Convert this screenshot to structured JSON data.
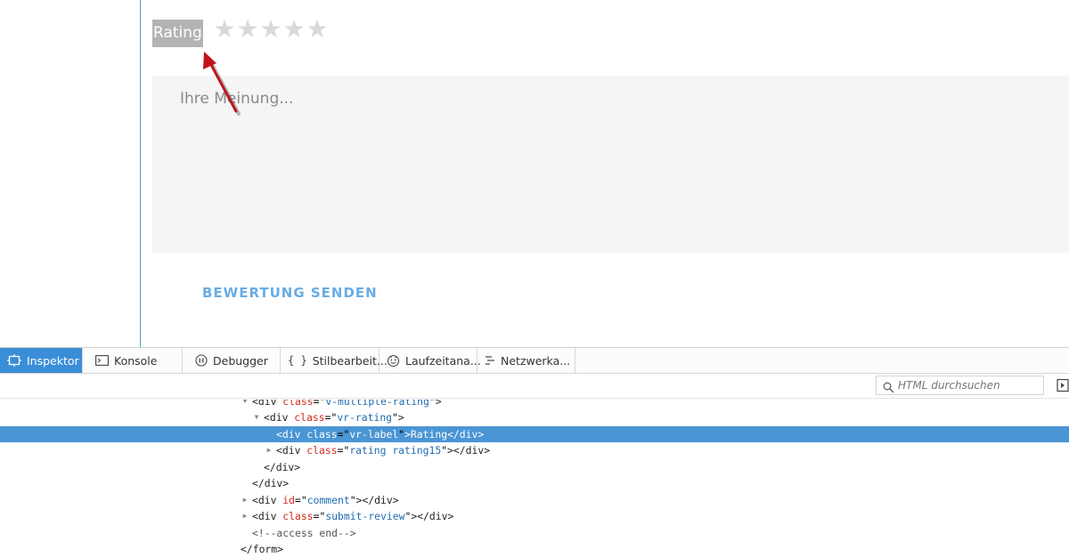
{
  "page": {
    "rating_label": "Rating",
    "rating": {
      "value": 0,
      "max": 5
    },
    "star_glyph": "★",
    "comment_placeholder": "Ihre Meinung...",
    "submit_label": "BEWERTUNG SENDEN"
  },
  "devtools": {
    "tabs": [
      {
        "label": "Inspektor",
        "icon": "inspector-icon",
        "active": true
      },
      {
        "label": "Konsole",
        "icon": "console-icon",
        "active": false
      },
      {
        "label": "Debugger",
        "icon": "debugger-icon",
        "active": false
      },
      {
        "label": "Stilbearbeit...",
        "icon": "style-editor-icon",
        "active": false
      },
      {
        "label": "Laufzeitana...",
        "icon": "performance-icon",
        "active": false
      },
      {
        "label": "Netzwerka...",
        "icon": "network-icon",
        "active": false
      }
    ],
    "search_placeholder": "HTML durchsuchen",
    "selected_node_index": 2,
    "nodes": [
      {
        "twisty": "open",
        "open": "<",
        "tag": "div",
        "attr": "class",
        "value": "v-multiple-rating",
        "close": ">"
      },
      {
        "twisty": "open",
        "open": "<",
        "tag": "div",
        "attr": "class",
        "value": "vr-rating",
        "close": ">"
      },
      {
        "twisty": "none",
        "open": "<",
        "tag": "div",
        "attr": "class",
        "value": "vr-label",
        "close": ">",
        "text": "Rating",
        "end": "</div>"
      },
      {
        "twisty": "closed",
        "open": "<",
        "tag": "div",
        "attr": "class",
        "value": "rating rating15",
        "close": ">",
        "end": "</div>"
      },
      {
        "twisty": "none",
        "raw": "</div>"
      },
      {
        "twisty": "none",
        "raw": "</div>"
      },
      {
        "twisty": "closed",
        "open": "<",
        "tag": "div",
        "attr": "id",
        "value": "comment",
        "close": ">",
        "end": "</div>"
      },
      {
        "twisty": "closed",
        "open": "<",
        "tag": "div",
        "attr": "class",
        "value": "submit-review",
        "close": ">",
        "end": "</div>"
      },
      {
        "twisty": "none",
        "comment": "<!--access end-->"
      },
      {
        "twisty": "none",
        "raw": "</form>"
      }
    ]
  },
  "colors": {
    "accent": "#3a8ed8",
    "selection": "#4a95d4",
    "submit": "#6aace3",
    "annotation_arrow": "#c0141c"
  }
}
